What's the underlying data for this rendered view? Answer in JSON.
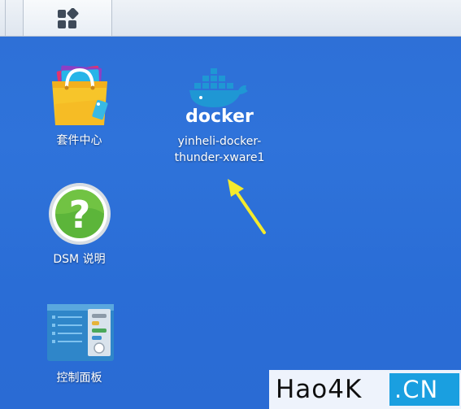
{
  "taskbar": {
    "main_menu_icon": "grid-menu-icon"
  },
  "desktop": {
    "icons": [
      {
        "label": "套件中心",
        "icon": "package-center-icon"
      },
      {
        "label": "yinheli-docker-\nthunder-xware1",
        "label_line1": "yinheli-docker-",
        "label_line2": "thunder-xware1",
        "icon": "docker-icon",
        "logo_text": "docker"
      },
      {
        "label": "DSM 说明",
        "icon": "help-question-icon"
      },
      {
        "label": "控制面板",
        "icon": "control-panel-icon"
      }
    ]
  },
  "annotation": {
    "arrow_color": "#f4ea2c"
  },
  "watermark": {
    "site": "Hao4K",
    "tld": ".CN"
  },
  "colors": {
    "desktop_bg": "#2d6fd6",
    "watermark_badge": "#1a9fe0"
  }
}
